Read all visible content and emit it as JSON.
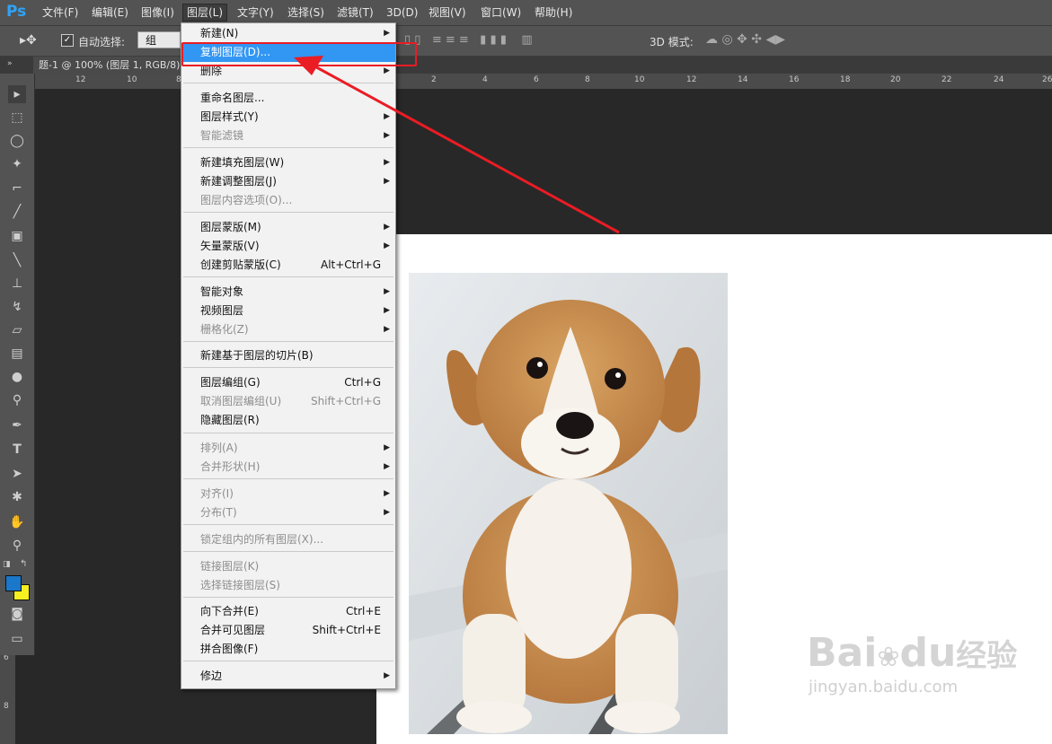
{
  "app": {
    "logo": "Ps"
  },
  "menubar": {
    "items": [
      {
        "label": "文件(F)"
      },
      {
        "label": "编辑(E)"
      },
      {
        "label": "图像(I)"
      },
      {
        "label": "图层(L)"
      },
      {
        "label": "文字(Y)"
      },
      {
        "label": "选择(S)"
      },
      {
        "label": "滤镜(T)"
      },
      {
        "label": "3D(D)"
      },
      {
        "label": "视图(V)"
      },
      {
        "label": "窗口(W)"
      },
      {
        "label": "帮助(H)"
      }
    ]
  },
  "options_bar": {
    "auto_select_label": "自动选择:",
    "auto_select_value": "组",
    "mode_3d_label": "3D 模式:"
  },
  "document_tab": {
    "title": "题-1 @ 100% (图层 1, RGB/8) *"
  },
  "ruler": {
    "h_ticks": [
      "12",
      "10",
      "8",
      "2",
      "4",
      "6",
      "8",
      "10",
      "12",
      "14",
      "16",
      "18",
      "20",
      "22",
      "24",
      "26"
    ],
    "v_ticks": [
      "6",
      "8"
    ]
  },
  "layer_menu": {
    "items": [
      {
        "label": "新建(N)",
        "submenu": true
      },
      {
        "label": "复制图层(D)...",
        "highlight": true
      },
      {
        "label": "删除",
        "submenu": true
      },
      {
        "label": "重命名图层..."
      },
      {
        "label": "图层样式(Y)",
        "submenu": true
      },
      {
        "label": "智能滤镜",
        "submenu": true,
        "disabled": true
      },
      {
        "label": "新建填充图层(W)",
        "submenu": true
      },
      {
        "label": "新建调整图层(J)",
        "submenu": true
      },
      {
        "label": "图层内容选项(O)...",
        "disabled": true
      },
      {
        "label": "图层蒙版(M)",
        "submenu": true
      },
      {
        "label": "矢量蒙版(V)",
        "submenu": true
      },
      {
        "label": "创建剪贴蒙版(C)",
        "shortcut": "Alt+Ctrl+G"
      },
      {
        "label": "智能对象",
        "submenu": true
      },
      {
        "label": "视频图层",
        "submenu": true
      },
      {
        "label": "栅格化(Z)",
        "submenu": true,
        "disabled": true
      },
      {
        "label": "新建基于图层的切片(B)"
      },
      {
        "label": "图层编组(G)",
        "shortcut": "Ctrl+G"
      },
      {
        "label": "取消图层编组(U)",
        "shortcut": "Shift+Ctrl+G",
        "disabled": true
      },
      {
        "label": "隐藏图层(R)"
      },
      {
        "label": "排列(A)",
        "submenu": true,
        "disabled": true
      },
      {
        "label": "合并形状(H)",
        "submenu": true,
        "disabled": true
      },
      {
        "label": "对齐(I)",
        "submenu": true,
        "disabled": true
      },
      {
        "label": "分布(T)",
        "submenu": true,
        "disabled": true
      },
      {
        "label": "锁定组内的所有图层(X)...",
        "disabled": true
      },
      {
        "label": "链接图层(K)",
        "disabled": true
      },
      {
        "label": "选择链接图层(S)",
        "disabled": true
      },
      {
        "label": "向下合并(E)",
        "shortcut": "Ctrl+E"
      },
      {
        "label": "合并可见图层",
        "shortcut": "Shift+Ctrl+E"
      },
      {
        "label": "拼合图像(F)"
      },
      {
        "label": "修边",
        "submenu": true
      }
    ]
  },
  "watermark": {
    "brand": "Bai",
    "brand2": "du",
    "product": "经验",
    "url": "jingyan.baidu.com"
  },
  "colors": {
    "highlight": "#3296f3",
    "annotation": "#ea1c24",
    "foreground_swatch": "#1a77c9",
    "background_swatch": "#f7ef20"
  }
}
